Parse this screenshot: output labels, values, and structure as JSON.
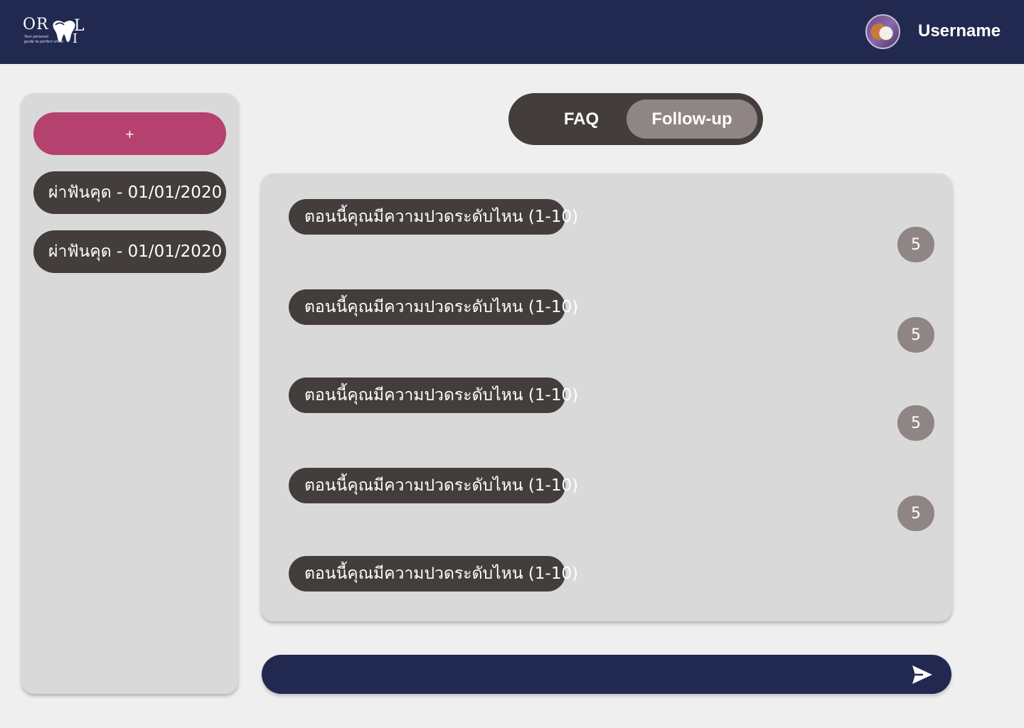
{
  "header": {
    "logo": {
      "top_letters": "OR",
      "right_letter": "L",
      "bottom_letter": "I",
      "tagline_line1": "Your personal",
      "tagline_line2": "guide to perfect smile",
      "icon": "tooth-icon"
    },
    "avatar_icon": "cat-avatar",
    "username": "Username"
  },
  "sidebar": {
    "new_button_label": "+",
    "history": [
      {
        "label": "ผ่าฟันคุด - 01/01/2020"
      },
      {
        "label": "ผ่าฟันคุด - 01/01/2020"
      }
    ]
  },
  "tabs": [
    {
      "label": "FAQ",
      "active": false
    },
    {
      "label": "Follow-up",
      "active": true
    }
  ],
  "chat": {
    "messages": [
      {
        "question": "ตอนนี้คุณมีความปวดระดับไหน (1-10)",
        "answer": "5"
      },
      {
        "question": "ตอนนี้คุณมีความปวดระดับไหน (1-10)",
        "answer": "5"
      },
      {
        "question": "ตอนนี้คุณมีความปวดระดับไหน (1-10)",
        "answer": "5"
      },
      {
        "question": "ตอนนี้คุณมีความปวดระดับไหน (1-10)",
        "answer": "5"
      },
      {
        "question": "ตอนนี้คุณมีความปวดระดับไหน (1-10)",
        "answer": null
      }
    ]
  },
  "composer": {
    "value": "",
    "placeholder": "",
    "send_icon": "send-icon"
  },
  "colors": {
    "navy": "#212950",
    "accent_pink": "#b5416f",
    "bubble_dark": "#433d3c",
    "bubble_grey": "#8e8584",
    "panel_grey": "#d9d9d9",
    "background": "#efefef"
  }
}
